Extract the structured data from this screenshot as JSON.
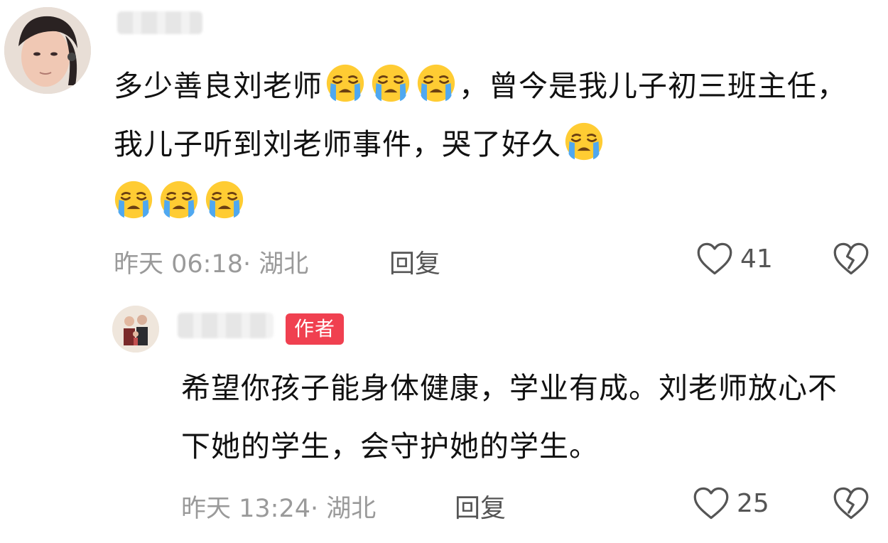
{
  "comments": [
    {
      "text_parts": {
        "a": "多少善良刘老师",
        "b": "，曾今是我儿子初三",
        "c": "班主任，我儿子听到刘老师事件，哭了好久"
      },
      "emoji_icon": "loudly-crying-face-icon",
      "timestamp": "昨天 06:18",
      "location": "湖北",
      "reply_label": "回复",
      "like_count": "41"
    }
  ],
  "reply": {
    "author_badge": "作者",
    "text": "希望你孩子能身体健康，学业有成。刘老师放心不下她的学生，会守护她的学生。",
    "timestamp": "昨天 13:24",
    "location": "湖北",
    "reply_label": "回复",
    "like_count": "25"
  },
  "colors": {
    "badge": "#f04050",
    "meta": "#9a9a9a"
  }
}
